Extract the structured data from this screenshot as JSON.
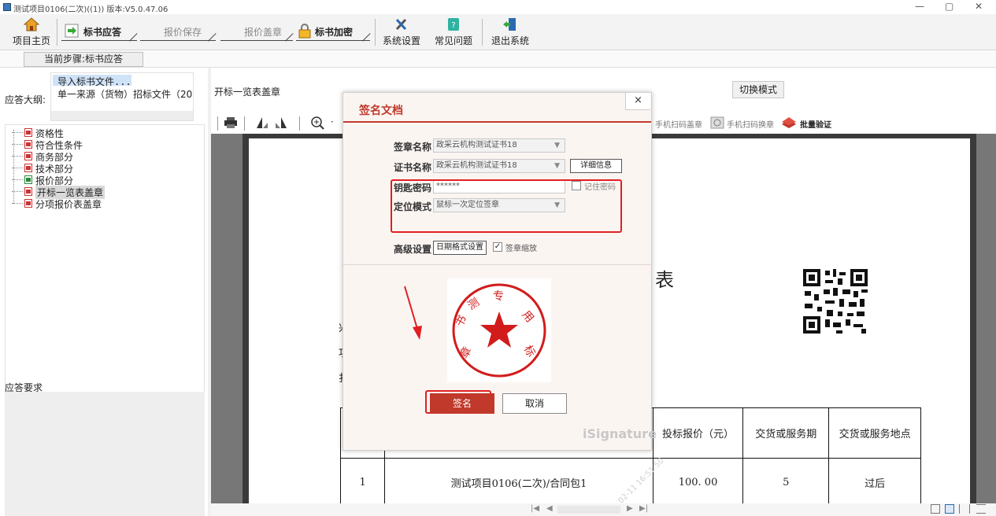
{
  "window": {
    "title": "测试项目0106(二次)((1)) 版本:V5.0.47.06",
    "minimize": "—",
    "restore": "▢",
    "close": "✕"
  },
  "toolbar": {
    "home": "项目主页",
    "steps": [
      "标书应答",
      "报价保存",
      "报价盖章",
      "标书加密"
    ],
    "settings": "系统设置",
    "faq": "常见问题",
    "exit": "退出系统"
  },
  "step_tab": "当前步骤:标书应答",
  "left": {
    "outline_label": "应答大纲:",
    "outline_items": [
      "导入标书文件...",
      "单一来源（货物）招标文件（20"
    ],
    "tree": [
      "资格性",
      "符合性条件",
      "商务部分",
      "技术部分",
      "报价部分",
      "开标一览表盖章",
      "分项报价表盖章"
    ],
    "requirements_label": "应答要求"
  },
  "main": {
    "doc_title": "开标一览表盖章",
    "switch_mode": "切换模式",
    "phone_sign": "手机扫码盖章",
    "phone_sign_swap": "手机扫码换章",
    "batch_verify": "批量验证",
    "page_heading_char": "表",
    "table": {
      "headers": [
        "投标报价（元）",
        "交货或服务期",
        "交货或服务地点"
      ],
      "row": [
        "1",
        "测试项目0106(二次)/合同包1",
        "100. 00",
        "5",
        "过后"
      ]
    },
    "watermark": "02-11 16:51:50",
    "side_chars": [
      "兴",
      "功",
      "扌"
    ]
  },
  "dialog": {
    "title": "签名文档",
    "close": "×",
    "seal_name_label": "签章名称",
    "seal_name_value": "政采云机构测试证书18",
    "cert_name_label": "证书名称",
    "cert_name_value": "政采云机构测试证书18",
    "detail_button": "详细信息",
    "pin_label": "钥匙密码",
    "pin_value": "******",
    "remember_pin": "记住密码",
    "position_label": "定位模式",
    "position_value": "鼠标一次定位签章",
    "advanced_label": "高级设置",
    "date_format_button": "日期格式设置",
    "scale_seal": "签章缩放",
    "sign_button": "签名",
    "cancel_button": "取消",
    "brand": "iSignature",
    "seal_text": [
      "专",
      "用",
      "章",
      "标",
      "书",
      "测"
    ]
  },
  "colors": {
    "accent_red": "#c0392b",
    "highlight_red": "#e02020",
    "selection_blue": "#cfe3f8"
  }
}
